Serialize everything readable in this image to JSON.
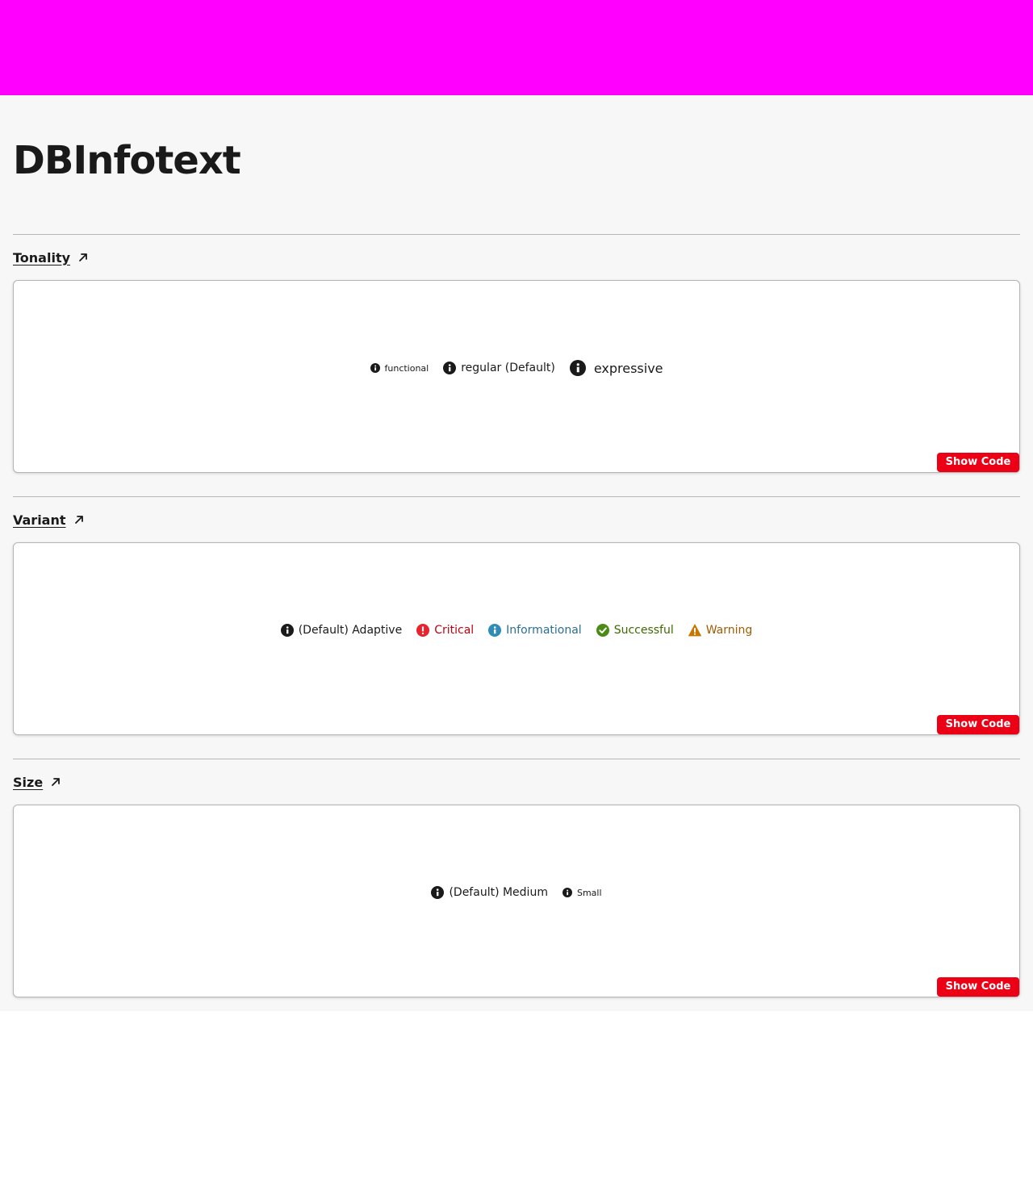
{
  "page": {
    "title": "DBInfotext"
  },
  "colors": {
    "topbar": "#ff00ff",
    "background": "#f7f7f7",
    "accent": "#ec0016",
    "adaptive": "#1a1a1a",
    "critical": "#e8232d",
    "informational": "#2f8bb8",
    "successful": "#4c8a16",
    "warning": "#c77700"
  },
  "sections": [
    {
      "heading": "Tonality",
      "heading_icon": "arrow-up-right-icon",
      "examples": [
        {
          "label": "functional",
          "icon": "info-icon"
        },
        {
          "label": "regular (Default)",
          "icon": "info-icon"
        },
        {
          "label": "expressive",
          "icon": "info-icon"
        }
      ],
      "show_code_label": "Show Code"
    },
    {
      "heading": "Variant",
      "heading_icon": "arrow-up-right-icon",
      "examples": [
        {
          "label": "(Default) Adaptive",
          "icon": "info-icon"
        },
        {
          "label": "Critical",
          "icon": "exclamation-icon"
        },
        {
          "label": "Informational",
          "icon": "info-icon"
        },
        {
          "label": "Successful",
          "icon": "check-circle-icon"
        },
        {
          "label": "Warning",
          "icon": "warning-triangle-icon"
        }
      ],
      "show_code_label": "Show Code"
    },
    {
      "heading": "Size",
      "heading_icon": "arrow-up-right-icon",
      "examples": [
        {
          "label": "(Default) Medium",
          "icon": "info-icon"
        },
        {
          "label": "Small",
          "icon": "info-icon"
        }
      ],
      "show_code_label": "Show Code"
    }
  ]
}
